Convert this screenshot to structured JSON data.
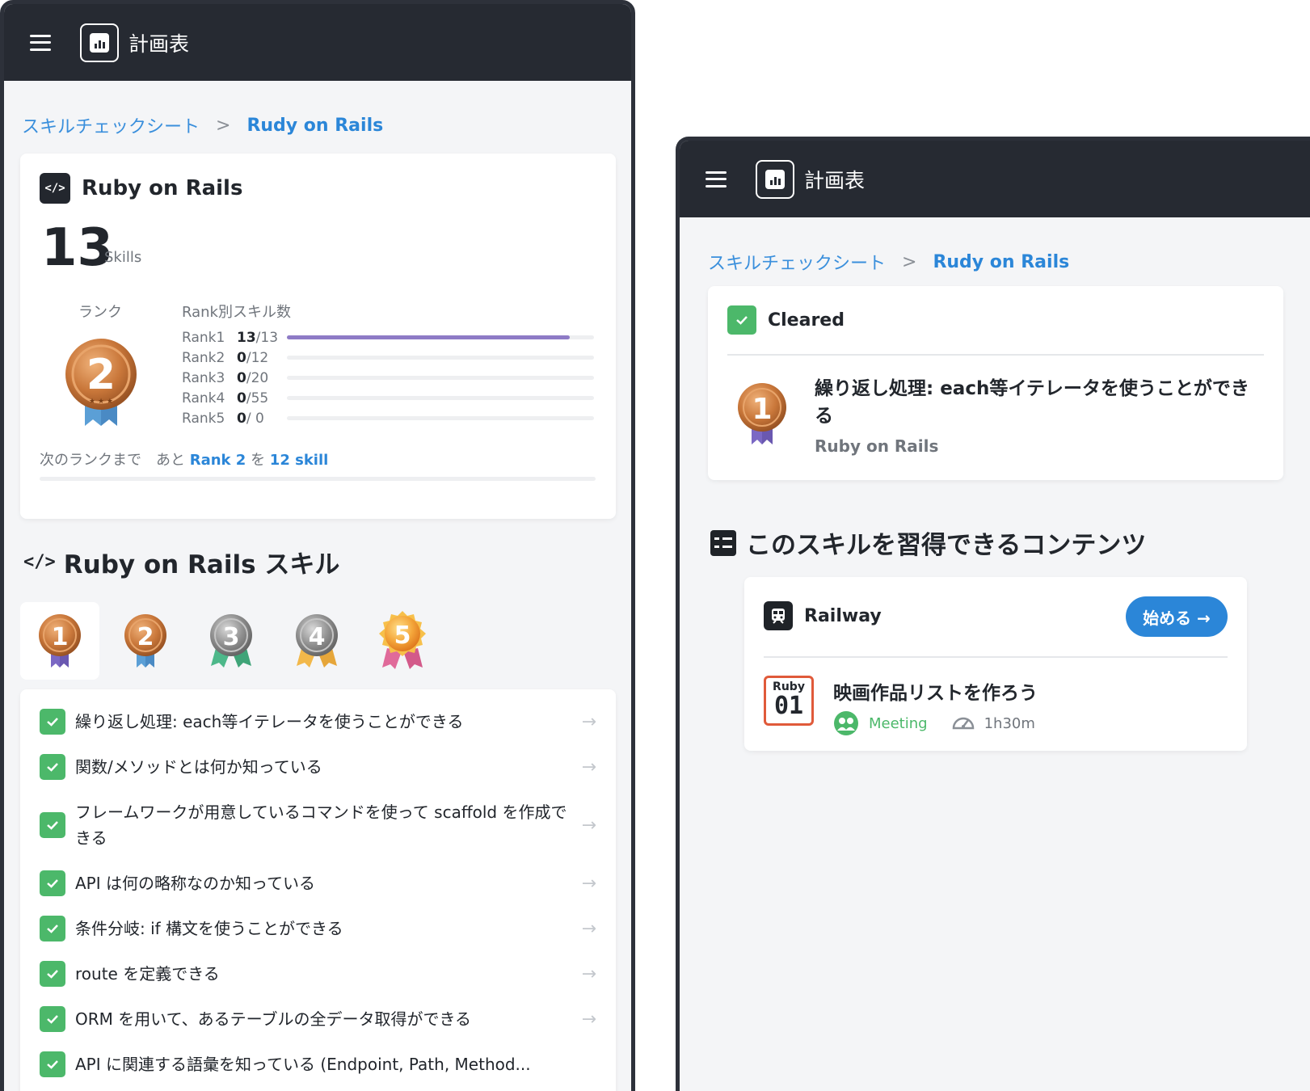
{
  "app": {
    "title": "計画表"
  },
  "breadcrumb": {
    "root": "スキルチェックシート",
    "separator": ">",
    "current": "Rudy on Rails"
  },
  "summary": {
    "title": "Ruby on Rails",
    "code_icon": "</>",
    "skill_count": "13",
    "skill_unit": "Skills",
    "rank_label": "ランク",
    "rank_count_label": "Rank別スキル数",
    "current_rank": "2",
    "ranks": [
      {
        "name": "Rank1",
        "done": "13",
        "total": "/13",
        "progress": 1.0
      },
      {
        "name": "Rank2",
        "done": "0",
        "total": "/12",
        "progress": 0
      },
      {
        "name": "Rank3",
        "done": "0",
        "total": "/20",
        "progress": 0
      },
      {
        "name": "Rank4",
        "done": "0",
        "total": "/55",
        "progress": 0
      },
      {
        "name": "Rank5",
        "done": "0",
        "total": "/ 0",
        "progress": 0
      }
    ],
    "next_rank": {
      "prefix": "次のランクまで　あと",
      "rank": "Rank 2",
      "particle": "を",
      "skills": "12 skill",
      "progress": 0
    }
  },
  "skills_section": {
    "heading": "Ruby on Rails スキル",
    "icon": "</>",
    "medal_tabs": [
      "1",
      "2",
      "3",
      "4",
      "5"
    ],
    "items": [
      {
        "text": "繰り返し処理: each等イテレータを使うことができる"
      },
      {
        "text": "関数/メソッドとは何か知っている"
      },
      {
        "text": "フレームワークが用意しているコマンドを使って scaffold を作成できる"
      },
      {
        "text": "API は何の略称なのか知っている"
      },
      {
        "text": "条件分岐: if 構文を使うことができる"
      },
      {
        "text": "route を定義できる"
      },
      {
        "text": "ORM を用いて、あるテーブルの全データ取得ができる"
      },
      {
        "text": "API に関連する語彙を知っている (Endpoint, Path, Method..."
      }
    ],
    "arrow": "→"
  },
  "cleared": {
    "label": "Cleared",
    "medal_rank": "1",
    "title": "繰り返し処理: each等イテレータを使うことができる",
    "subtitle": "Ruby on Rails"
  },
  "contents": {
    "heading": "このスキルを習得できるコンテンツ",
    "provider": "Railway",
    "start_button": "始める →",
    "badge_top": "Ruby",
    "badge_num": "01",
    "lesson_title": "映画作品リストを作ろう",
    "meeting": "Meeting",
    "duration": "1h30m"
  },
  "colors": {
    "bronze": "#c97a3a",
    "silver": "#8b8b8b",
    "gold": "#f2a23a",
    "accent": "#2b86d8",
    "check": "#4cb86a",
    "ribbon_rank1": "#7b68c4",
    "ribbon_rank2": "#5b9fd6",
    "ribbon_rank3": "#4db88a",
    "ribbon_rank4": "#f2b84a",
    "ribbon_rank5": "#e06a9a"
  }
}
